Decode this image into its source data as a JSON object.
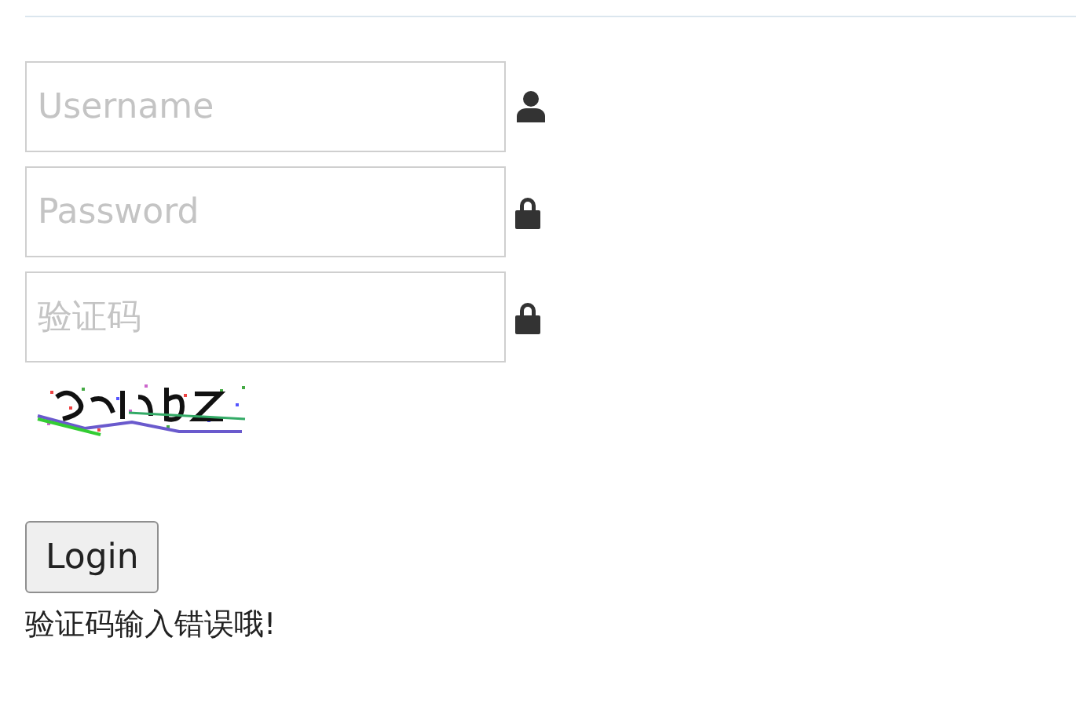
{
  "fields": [
    {
      "kind": "user",
      "placeholder": "Username"
    },
    {
      "kind": "lock",
      "placeholder": "Password"
    },
    {
      "kind": "lock",
      "placeholder": "验证码"
    }
  ],
  "login_button": "Login",
  "error_message": "验证码输入错误哦!"
}
